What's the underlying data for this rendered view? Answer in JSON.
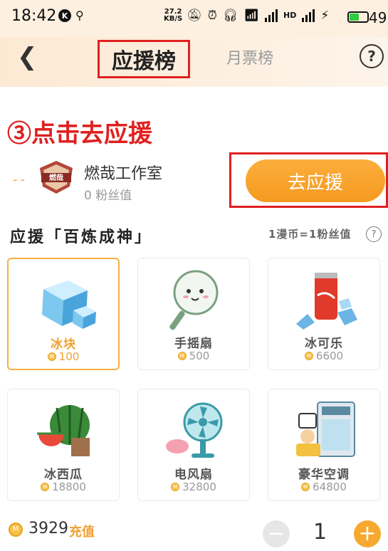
{
  "status_bar": {
    "time": "18:42",
    "k_badge": "K",
    "speed_value": "27.2",
    "speed_unit": "KB/S",
    "network_label": "4G",
    "battery": "49"
  },
  "header": {
    "back_icon": "chevron-left-icon",
    "tabs": [
      {
        "label": "应援榜",
        "active": true
      },
      {
        "label": "月票榜",
        "active": false
      }
    ],
    "help_label": "?"
  },
  "annotation": {
    "text": "③点击去应援",
    "color": "#e02020"
  },
  "studio": {
    "dash": "--",
    "logo_text": "燃哉",
    "name": "燃哉工作室",
    "fans": "0 粉丝值",
    "support_button": "去应援"
  },
  "section": {
    "title": "应援「百炼成神」",
    "rate": "1漫币=1粉丝值",
    "help_label": "?"
  },
  "gifts": [
    {
      "name": "冰块",
      "price": "100",
      "selected": true,
      "icon": "ice-cube-icon"
    },
    {
      "name": "手摇扇",
      "price": "500",
      "selected": false,
      "icon": "hand-fan-icon"
    },
    {
      "name": "冰可乐",
      "price": "6600",
      "selected": false,
      "icon": "iced-cola-icon"
    },
    {
      "name": "冰西瓜",
      "price": "18800",
      "selected": false,
      "icon": "watermelon-icon"
    },
    {
      "name": "电风扇",
      "price": "32800",
      "selected": false,
      "icon": "electric-fan-icon"
    },
    {
      "name": "豪华空调",
      "price": "64800",
      "selected": false,
      "icon": "air-conditioner-icon"
    }
  ],
  "coin_symbol": "M",
  "bottom": {
    "balance": "3929",
    "recharge": "充值",
    "minus": "−",
    "quantity": "1",
    "plus": "+"
  },
  "colors": {
    "accent": "#f7a82e",
    "annotation_red": "#e02020",
    "header_bg": "#fdf0e0"
  }
}
